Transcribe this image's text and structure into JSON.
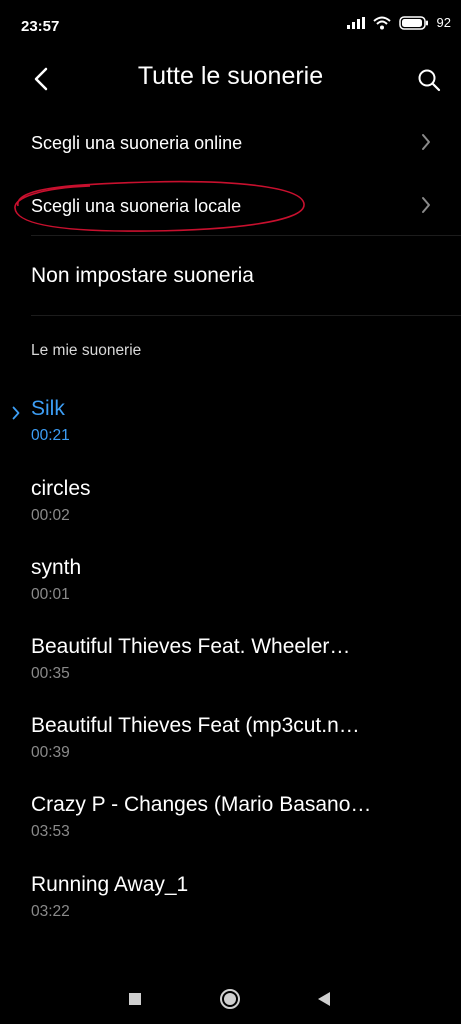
{
  "status_bar": {
    "time": "23:57",
    "battery": "92",
    "icons": [
      "signal-icon",
      "wifi-icon",
      "battery-icon"
    ]
  },
  "header": {
    "title": "Tutte le suonerie",
    "back_icon": "back-arrow-icon",
    "search_icon": "search-icon"
  },
  "options": {
    "online": "Scegli una suoneria online",
    "local": "Scegli una suoneria locale",
    "none": "Non impostare suoneria"
  },
  "section": {
    "title": "Le mie suonerie"
  },
  "ringtones": [
    {
      "name": "Silk",
      "duration": "00:21",
      "selected": true
    },
    {
      "name": "circles",
      "duration": "00:02",
      "selected": false
    },
    {
      "name": "synth",
      "duration": "00:01",
      "selected": false
    },
    {
      "name": "Beautiful Thieves Feat. Wheeler…",
      "duration": "00:35",
      "selected": false
    },
    {
      "name": "Beautiful Thieves Feat (mp3cut.n…",
      "duration": "00:39",
      "selected": false
    },
    {
      "name": "Crazy P - Changes (Mario Basano…",
      "duration": "03:53",
      "selected": false
    },
    {
      "name": "Running Away_1",
      "duration": "03:22",
      "selected": false
    }
  ],
  "colors": {
    "background": "#000000",
    "accent": "#3d9ef5",
    "annotation": "#c8102e"
  },
  "nav_bar": [
    "recents-square-icon",
    "home-circle-icon",
    "back-triangle-icon"
  ]
}
